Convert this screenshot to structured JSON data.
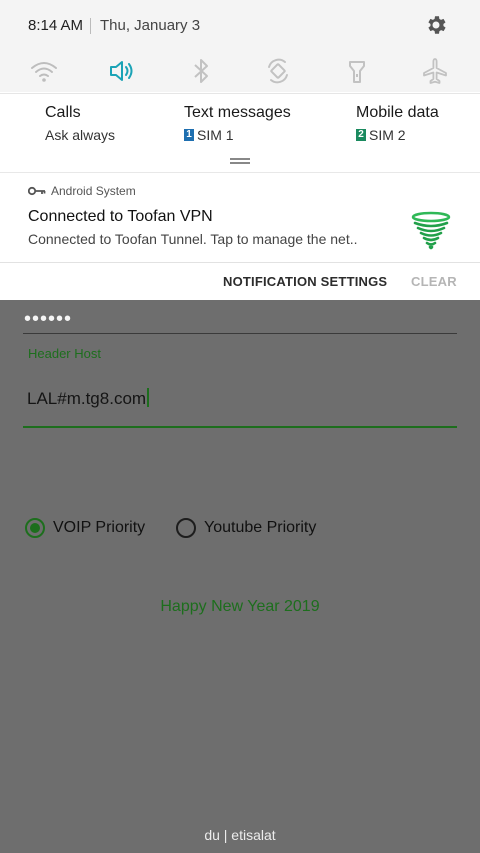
{
  "status_bar": {
    "time": "8:14 AM",
    "date": "Thu, January 3"
  },
  "quick_toggles": [
    {
      "name": "wifi-icon",
      "active": false
    },
    {
      "name": "sound-icon",
      "active": true
    },
    {
      "name": "bluetooth-icon",
      "active": false
    },
    {
      "name": "auto-rotate-icon",
      "active": false
    },
    {
      "name": "flashlight-icon",
      "active": false
    },
    {
      "name": "airplane-icon",
      "active": false
    }
  ],
  "sim": {
    "calls": {
      "title": "Calls",
      "value": "Ask always"
    },
    "text": {
      "title": "Text messages",
      "badge": "1",
      "value": "SIM 1",
      "badge_color": "#1e6fb0"
    },
    "data": {
      "title": "Mobile data",
      "badge": "2",
      "value": "SIM 2",
      "badge_color": "#1a8a5f"
    }
  },
  "notification": {
    "app": "Android System",
    "title": "Connected to Toofan VPN",
    "body": "Connected to Toofan Tunnel. Tap to manage the net.."
  },
  "actions": {
    "settings": "NOTIFICATION SETTINGS",
    "clear": "CLEAR"
  },
  "app": {
    "password_mask": "••••••",
    "header_host_label": "Header Host",
    "header_host_value": "LAL#m.tg8.com",
    "radio_voip": "VOIP Priority",
    "radio_youtube": "Youtube Priority",
    "selected": "voip",
    "greeting": "Happy New Year 2019",
    "carrier": "du | etisalat"
  },
  "colors": {
    "accent_green": "#1d6e1d",
    "toggle_active": "#1ba3b6"
  }
}
